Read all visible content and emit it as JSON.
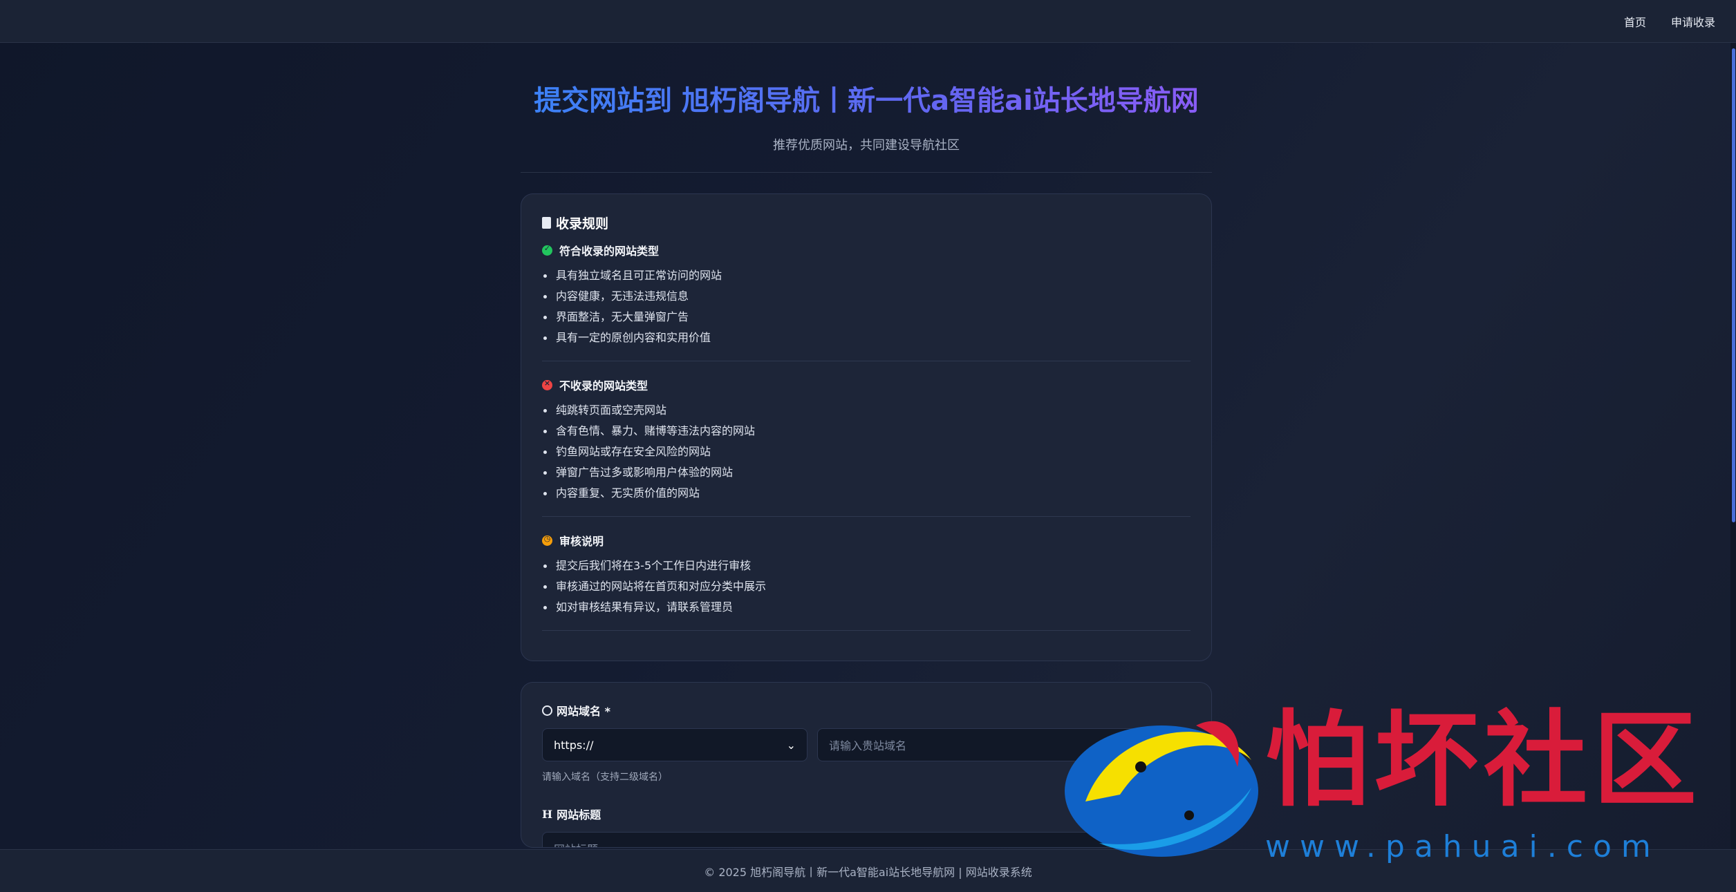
{
  "nav": {
    "home": "首页",
    "apply": "申请收录"
  },
  "header": {
    "title": "提交网站到 旭朽阁导航丨新一代a智能ai站长地导航网",
    "subtitle": "推荐优质网站，共同建设导航社区"
  },
  "rules": {
    "title": "收录规则",
    "accepted": {
      "title": "符合收录的网站类型",
      "items": [
        "具有独立域名且可正常访问的网站",
        "内容健康，无违法违规信息",
        "界面整洁，无大量弹窗广告",
        "具有一定的原创内容和实用价值"
      ]
    },
    "rejected": {
      "title": "不收录的网站类型",
      "items": [
        "纯跳转页面或空壳网站",
        "含有色情、暴力、赌博等违法内容的网站",
        "钓鱼网站或存在安全风险的网站",
        "弹窗广告过多或影响用户体验的网站",
        "内容重复、无实质价值的网站"
      ]
    },
    "review": {
      "title": "审核说明",
      "items": [
        "提交后我们将在3-5个工作日内进行审核",
        "审核通过的网站将在首页和对应分类中展示",
        "如对审核结果有异议，请联系管理员"
      ]
    }
  },
  "form": {
    "domain_label": "网站域名 *",
    "protocol_value": "https://",
    "domain_placeholder": "请输入贵站域名",
    "domain_hint": "请输入域名（支持二级域名）",
    "title_label": "网站标题",
    "title_placeholder": "网站标题"
  },
  "footer": {
    "text": "© 2025 旭朽阁导航丨新一代a智能ai站长地导航网 | 网站收录系统"
  },
  "watermark": {
    "text": "怕坏社区",
    "url": "www.pahuai.com"
  },
  "colors": {
    "accent": "#3b82f6",
    "ok": "#22c55e",
    "danger": "#ef4444",
    "warning": "#f59e0b"
  }
}
